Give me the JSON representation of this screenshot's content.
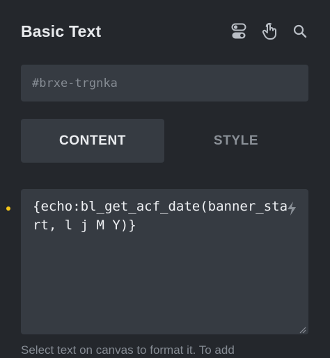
{
  "header": {
    "title": "Basic Text",
    "icons": [
      "toggle-icon",
      "hand-pointer-icon",
      "search-icon"
    ]
  },
  "element_id": {
    "value": "#brxe-trgnka"
  },
  "tabs": [
    {
      "label": "CONTENT",
      "active": true
    },
    {
      "label": "STYLE",
      "active": false
    }
  ],
  "editor": {
    "line1": "{echo:bl_get_acf_date(banner_sta",
    "line2": "rt, l j M Y)}"
  },
  "helper_text": "Select text on canvas to format it. To add",
  "colors": {
    "background": "#24272c",
    "field": "#363b42",
    "indicator_dot": "#f5c518",
    "text": "#eef0f3",
    "muted": "#868c94"
  }
}
